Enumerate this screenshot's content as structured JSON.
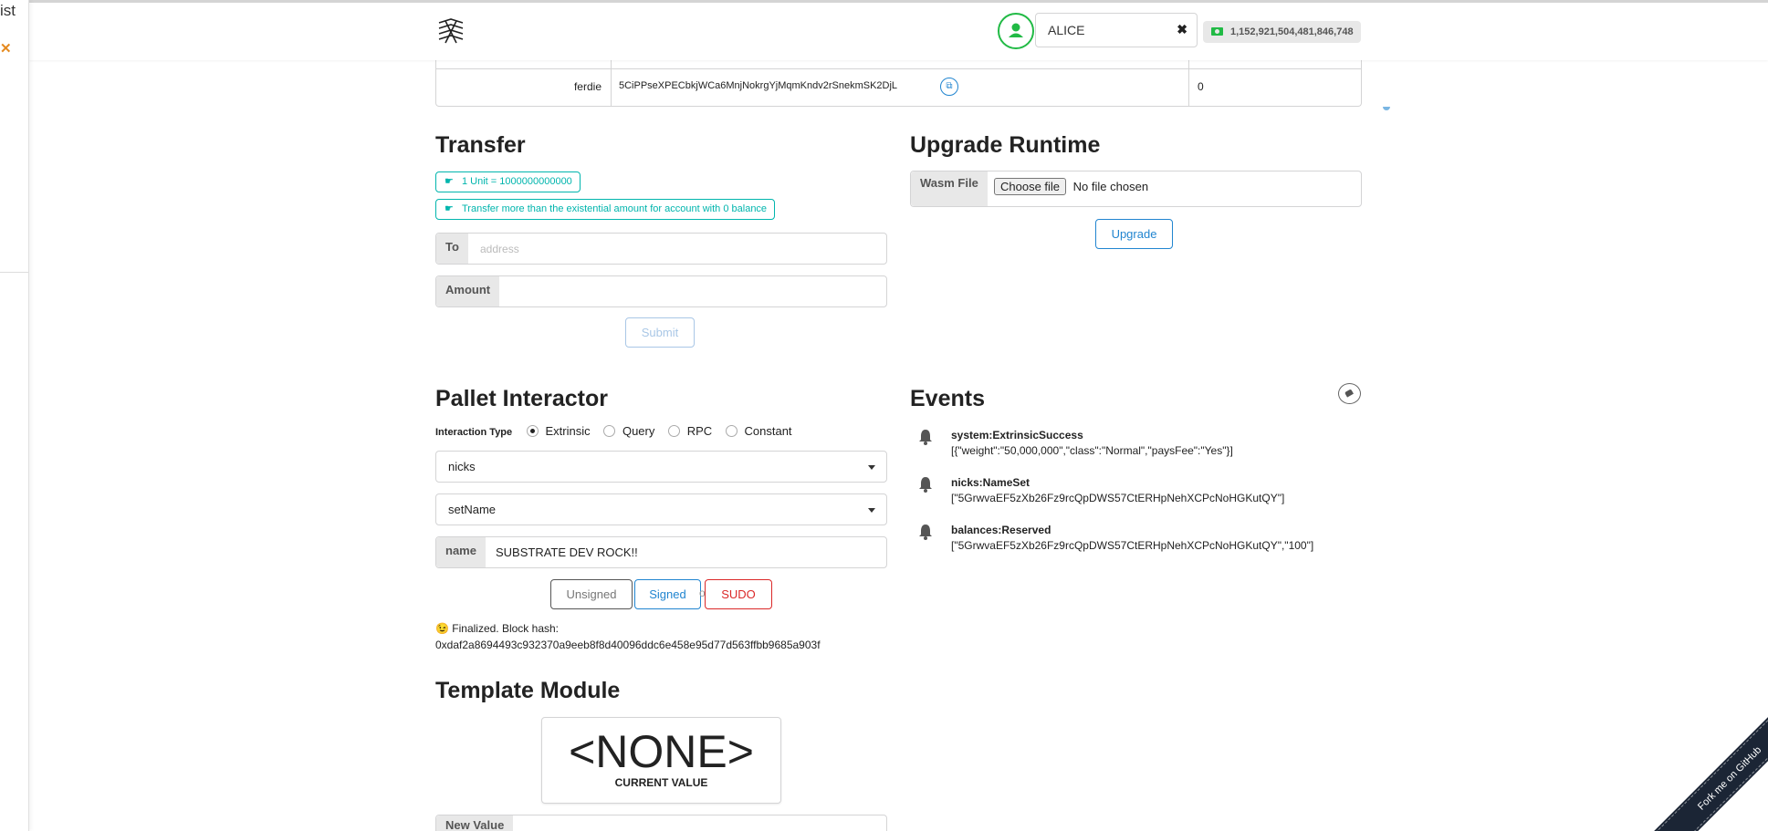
{
  "left_panel": {
    "text": "ist",
    "close": "✕"
  },
  "header": {
    "account_name": "ALICE",
    "clear_glyph": "✖",
    "balance": "1,152,921,504,481,846,748"
  },
  "accounts_table": {
    "row": {
      "name": "ferdie",
      "address": "5CiPPseXPECbkjWCa6MnjNokrgYjMqmKndv2rSnekmSK2DjL",
      "balance": "0"
    }
  },
  "transfer": {
    "title": "Transfer",
    "info_unit": "1 Unit = 1000000000000",
    "info_existential": "Transfer more than the existential amount for account with 0 balance",
    "to_label": "To",
    "to_placeholder": "address",
    "amount_label": "Amount",
    "submit_label": "Submit"
  },
  "upgrade": {
    "title": "Upgrade Runtime",
    "wasm_label": "Wasm File",
    "choose_file": "Choose file",
    "no_file": "No file chosen",
    "upgrade_label": "Upgrade"
  },
  "pallet": {
    "title": "Pallet Interactor",
    "interaction_label": "Interaction Type",
    "types": [
      "Extrinsic",
      "Query",
      "RPC",
      "Constant"
    ],
    "selected_type": "Extrinsic",
    "pallet_value": "nicks",
    "call_value": "setName",
    "param_label": "name",
    "param_value": "SUBSTRATE DEV ROCK!!",
    "unsigned": "Unsigned",
    "or": "or",
    "signed": "Signed",
    "sudo": "SUDO",
    "status_line1": "😉 Finalized. Block hash:",
    "status_line2": "0xdaf2a8694493c932370a9eeb8f8d40096ddc6e458e95d77d563ffbb9685a903f"
  },
  "events": {
    "title": "Events",
    "items": [
      {
        "name": "system:ExtrinsicSuccess",
        "data": "[{\"weight\":\"50,000,000\",\"class\":\"Normal\",\"paysFee\":\"Yes\"}]"
      },
      {
        "name": "nicks:NameSet",
        "data": "[\"5GrwvaEF5zXb26Fz9rcQpDWS57CtERHpNehXCPcNoHGKutQY\"]"
      },
      {
        "name": "balances:Reserved",
        "data": "[\"5GrwvaEF5zXb26Fz9rcQpDWS57CtERHpNehXCPcNoHGKutQY\",\"100\"]"
      }
    ]
  },
  "template": {
    "title": "Template Module",
    "value": "<NONE>",
    "value_caption": "CURRENT VALUE",
    "new_value_label": "New Value"
  },
  "ribbon": "Fork me on GitHub",
  "colors": {
    "teal": "#00b5ad",
    "blue": "#2185d0",
    "red": "#db2828",
    "green": "#21ba45"
  },
  "icons": [
    "substrate-logo-icon",
    "user-icon",
    "money-icon",
    "copy-icon",
    "hand-point-right-icon",
    "bell-icon",
    "eraser-icon"
  ]
}
